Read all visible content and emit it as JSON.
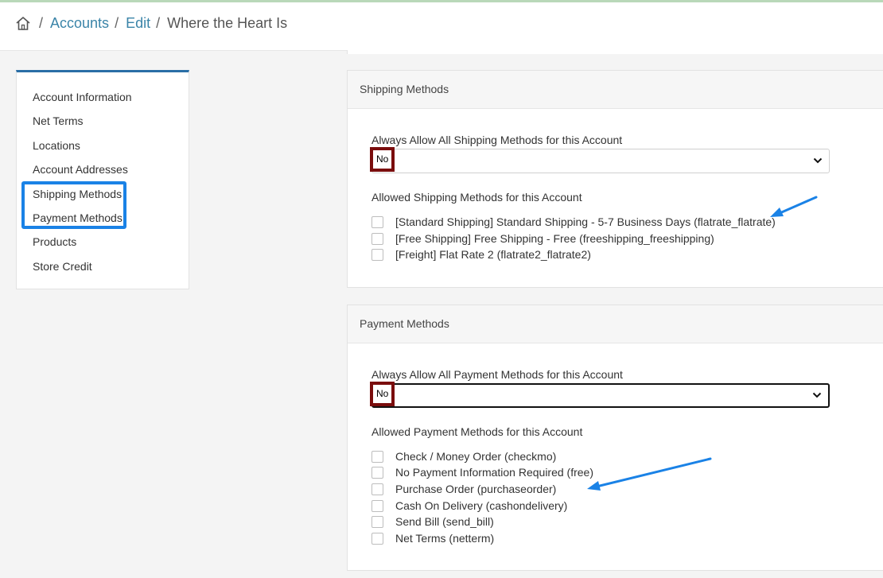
{
  "breadcrumb": {
    "home_icon": "home-icon",
    "items": [
      "Accounts",
      "Edit"
    ],
    "current": "Where the Heart Is",
    "separator": "/"
  },
  "sidebar": {
    "items": [
      {
        "label": "Account Information"
      },
      {
        "label": "Net Terms"
      },
      {
        "label": "Locations"
      },
      {
        "label": "Account Addresses"
      },
      {
        "label": "Shipping Methods"
      },
      {
        "label": "Payment Methods"
      },
      {
        "label": "Products"
      },
      {
        "label": "Store Credit"
      }
    ],
    "highlight_color": "#1a82e6"
  },
  "shipping": {
    "title": "Shipping Methods",
    "always_label": "Always Allow All Shipping Methods for this Account",
    "always_value": "No",
    "allowed_label": "Allowed Shipping Methods for this Account",
    "methods": [
      {
        "label": "[Standard Shipping] Standard Shipping - 5-7 Business Days (flatrate_flatrate)",
        "checked": false
      },
      {
        "label": "[Free Shipping] Free Shipping - Free (freeshipping_freeshipping)",
        "checked": false
      },
      {
        "label": "[Freight] Flat Rate 2 (flatrate2_flatrate2)",
        "checked": false
      }
    ]
  },
  "payment": {
    "title": "Payment Methods",
    "always_label": "Always Allow All Payment Methods for this Account",
    "always_value": "No",
    "allowed_label": "Allowed Payment Methods for this Account",
    "methods": [
      {
        "label": "Check / Money Order (checkmo)",
        "checked": false
      },
      {
        "label": "No Payment Information Required (free)",
        "checked": false
      },
      {
        "label": "Purchase Order (purchaseorder)",
        "checked": false
      },
      {
        "label": "Cash On Delivery (cashondelivery)",
        "checked": false
      },
      {
        "label": "Send Bill (send_bill)",
        "checked": false
      },
      {
        "label": "Net Terms (netterm)",
        "checked": false
      }
    ]
  },
  "colors": {
    "link": "#3a84a8",
    "annotation_arrow": "#1a82e6",
    "value_highlight": "#7a0d0d",
    "sidebar_accent": "#2a6ea6"
  }
}
